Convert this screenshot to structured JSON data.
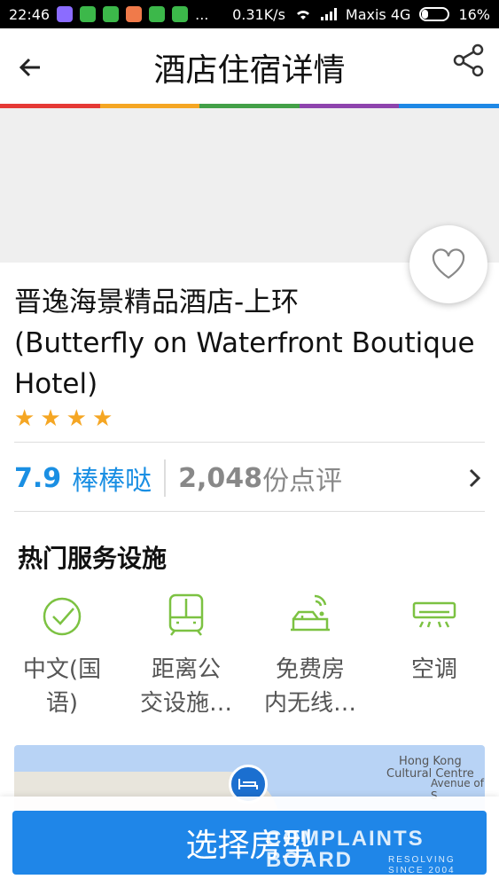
{
  "statusbar": {
    "time": "22:46",
    "dots": "...",
    "network_speed": "0.31K/s",
    "carrier": "Maxis 4G",
    "battery": "16%"
  },
  "header": {
    "title": "酒店住宿详情",
    "back_icon": "arrow-left-icon",
    "share_icon": "share-icon",
    "colors": [
      "#e53935",
      "#f5a623",
      "#43a047",
      "#8e44ad",
      "#1e88e5"
    ]
  },
  "hotel": {
    "name_line1": "晋逸海景精品酒店-上环",
    "name_line2": "(Butterfly on Waterfront Boutique",
    "name_line3": "Hotel)",
    "star_count": 4
  },
  "rating": {
    "score": "7.9",
    "label": "棒棒哒",
    "review_count": "2,048",
    "review_suffix": "份点评"
  },
  "amenities": {
    "title": "热门服务设施",
    "items": [
      {
        "icon": "check-circle-icon",
        "line1": "中文(国",
        "line2": "语)"
      },
      {
        "icon": "train-icon",
        "line1": "距离公",
        "line2": "交设施…"
      },
      {
        "icon": "wifi-bed-icon",
        "line1": "免费房",
        "line2": "内无线…"
      },
      {
        "icon": "air-conditioner-icon",
        "line1": "空调",
        "line2": ""
      }
    ]
  },
  "map": {
    "label1_line1": "Hong Kong",
    "label1_line2": "Cultural Centre",
    "label2": "Avenue of S"
  },
  "bottom": {
    "select_label": "选择房型"
  },
  "watermark": {
    "line1": "COMPLAINTS BOARD",
    "line2": "RESOLVING SINCE 2004"
  },
  "accent": "#1f86e8",
  "star_color": "#f5a623",
  "amenity_icon_color": "#7cc242"
}
